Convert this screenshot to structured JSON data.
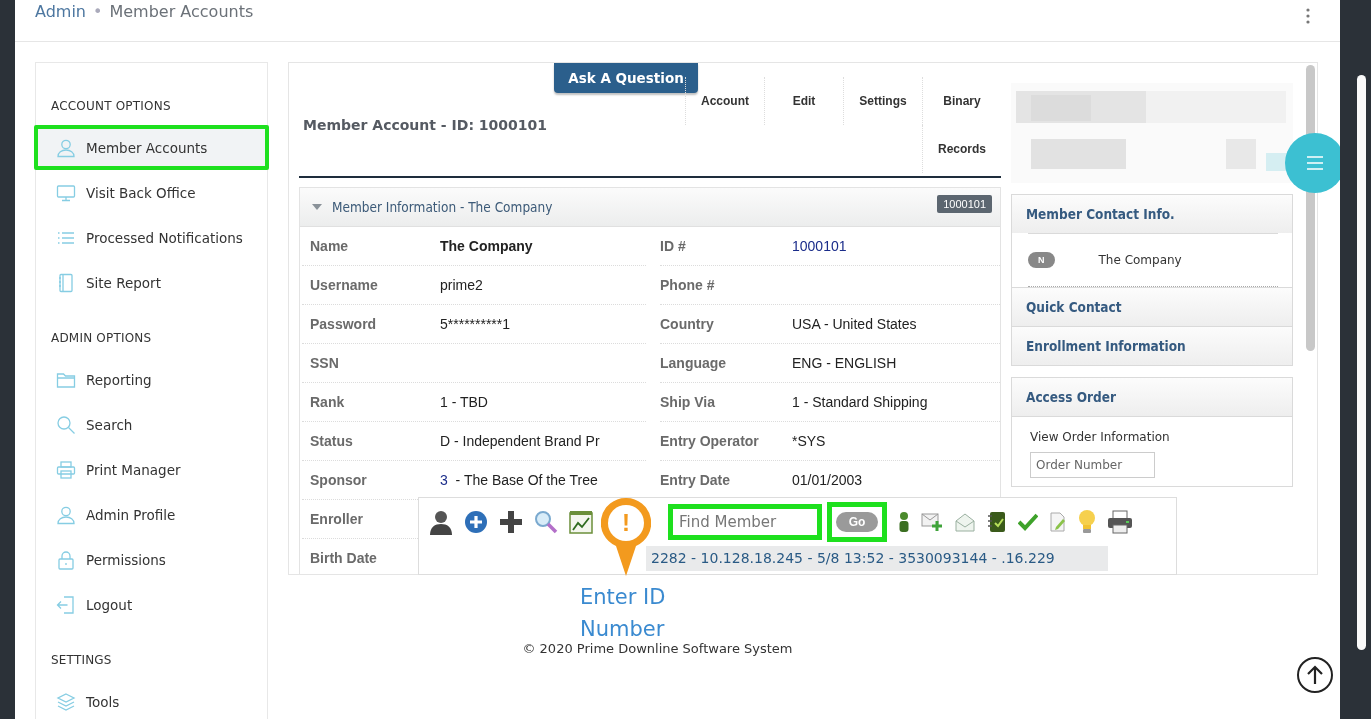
{
  "breadcrumb": {
    "parent": "Admin",
    "separator": "•",
    "current": "Member Accounts"
  },
  "sidebar": {
    "sections": [
      {
        "title": "ACCOUNT OPTIONS",
        "items": [
          {
            "label": "Member Accounts",
            "selected": true,
            "highlighted": true
          },
          {
            "label": "Visit Back Office",
            "selected": false,
            "highlighted": false
          },
          {
            "label": "Processed Notifications",
            "selected": false,
            "highlighted": false
          },
          {
            "label": "Site Report",
            "selected": false,
            "highlighted": false
          }
        ]
      },
      {
        "title": "ADMIN OPTIONS",
        "items": [
          {
            "label": "Reporting",
            "selected": false,
            "highlighted": false
          },
          {
            "label": "Search",
            "selected": false,
            "highlighted": false
          },
          {
            "label": "Print Manager",
            "selected": false,
            "highlighted": false
          },
          {
            "label": "Admin Profile",
            "selected": false,
            "highlighted": false
          },
          {
            "label": "Permissions",
            "selected": false,
            "highlighted": false
          },
          {
            "label": "Logout",
            "selected": false,
            "highlighted": false
          }
        ]
      },
      {
        "title": "SETTINGS",
        "items": [
          {
            "label": "Tools",
            "selected": false,
            "highlighted": false
          }
        ]
      }
    ]
  },
  "account": {
    "title": "Member Account - ID: 1000101",
    "ask_button": "Ask A Question",
    "tabs": [
      {
        "label": "Account"
      },
      {
        "label": "Edit"
      },
      {
        "label": "Settings"
      },
      {
        "label": "Binary"
      },
      {
        "label": "Records"
      }
    ]
  },
  "member_info": {
    "title": "Member Information - The Company",
    "badge": "1000101",
    "expanded": true,
    "columns": [
      [
        {
          "label": "Name",
          "value": "The Company",
          "kind": "bold"
        },
        {
          "label": "Username",
          "value": "prime2",
          "kind": "text"
        },
        {
          "label": "Password",
          "value": "5**********1",
          "kind": "text"
        },
        {
          "label": "SSN",
          "kind": "text"
        },
        {
          "label": "Rank",
          "value": "1 - TBD",
          "kind": "text"
        },
        {
          "label": "Status",
          "value": "D - Independent Brand Pr",
          "kind": "text"
        },
        {
          "label": "Sponsor",
          "link": "3",
          "value": "- The Base Of the Tree",
          "kind": "linked"
        },
        {
          "label": "Enroller",
          "kind": "text"
        },
        {
          "label": "Birth Date",
          "kind": "text"
        }
      ],
      [
        {
          "label": "ID #",
          "value": "1000101",
          "kind": "link"
        },
        {
          "label": "Phone #",
          "kind": "text"
        },
        {
          "label": "Country",
          "value": "USA - United States",
          "kind": "text"
        },
        {
          "label": "Language",
          "value": "ENG - ENGLISH",
          "kind": "text"
        },
        {
          "label": "Ship Via",
          "value": "1 - Standard Shipping",
          "kind": "text"
        },
        {
          "label": "Entry Operator",
          "value": "*SYS",
          "kind": "text"
        },
        {
          "label": "Entry Date",
          "value": "01/01/2003",
          "kind": "text"
        }
      ]
    ]
  },
  "contact": {
    "title": "Member Contact Info.",
    "badge": "N",
    "name": "The Company",
    "sections": [
      "Quick Contact",
      "Enrollment Information"
    ]
  },
  "access_order": {
    "title": "Access Order",
    "caption": "View Order Information",
    "placeholder": "Order Number"
  },
  "toolbar": {
    "search_placeholder": "Find Member",
    "go": "Go",
    "field_highlighted": true,
    "go_highlighted": true,
    "info": "2282 - 10.128.18.245 - 5/8 13:52 - 3530093144 - .16.229"
  },
  "annotation": {
    "mark": "!",
    "text": "Enter ID Number"
  },
  "footer": "© 2020 Prime Downline Software System"
}
